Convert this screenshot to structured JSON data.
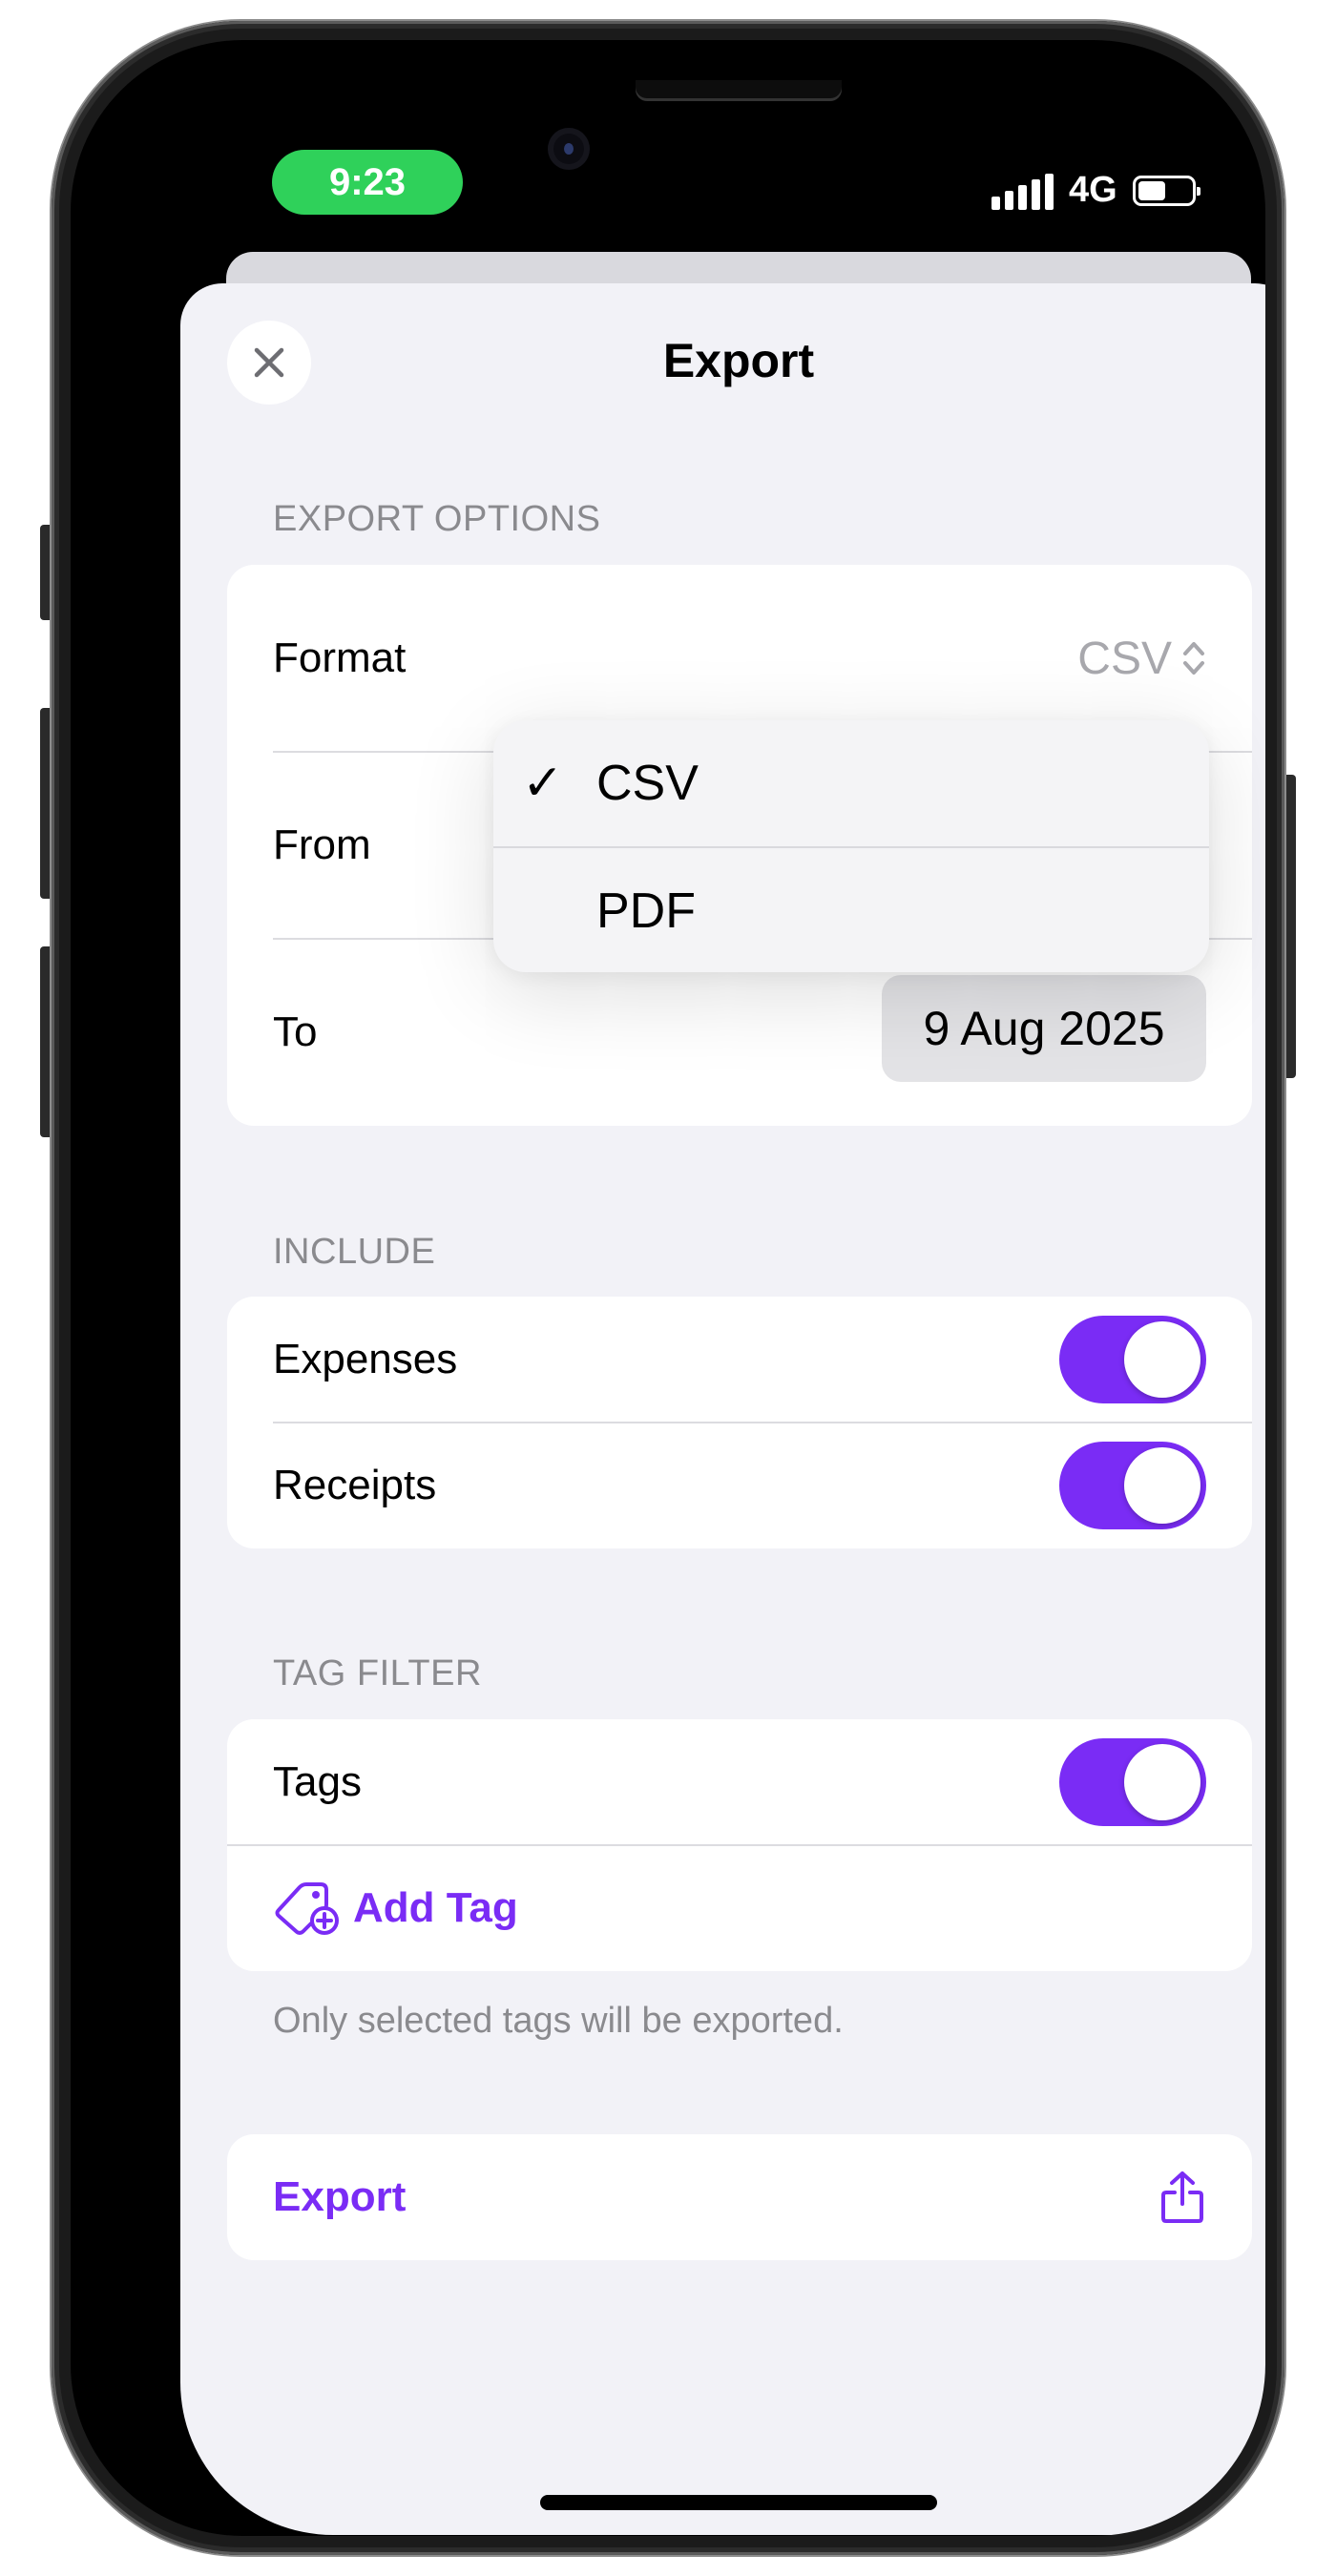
{
  "status_bar": {
    "time": "9:23",
    "network": "4G",
    "icons": [
      "signal-icon",
      "battery-icon"
    ]
  },
  "sheet": {
    "title": "Export",
    "close_icon": "close-icon"
  },
  "export_options": {
    "section_label": "EXPORT OPTIONS",
    "format": {
      "label": "Format",
      "value": "CSV",
      "icon": "chevron-updown-icon"
    },
    "from": {
      "label": "From"
    },
    "to": {
      "label": "To",
      "value": "9 Aug 2025"
    }
  },
  "format_menu": {
    "items": [
      {
        "label": "CSV",
        "selected": true,
        "check": "✓"
      },
      {
        "label": "PDF",
        "selected": false
      }
    ]
  },
  "include": {
    "section_label": "INCLUDE",
    "items": [
      {
        "label": "Expenses",
        "on": true
      },
      {
        "label": "Receipts",
        "on": true
      }
    ]
  },
  "tag_filter": {
    "section_label": "TAG FILTER",
    "tags": {
      "label": "Tags",
      "on": true
    },
    "add_tag": {
      "label": "Add Tag",
      "icon": "tag-plus-icon"
    },
    "footnote": "Only selected tags will be exported."
  },
  "export_button": {
    "label": "Export",
    "icon": "share-icon"
  },
  "colors": {
    "accent": "#7a2cf5",
    "time_pill": "#2fd15a",
    "background": "#f2f2f7"
  }
}
